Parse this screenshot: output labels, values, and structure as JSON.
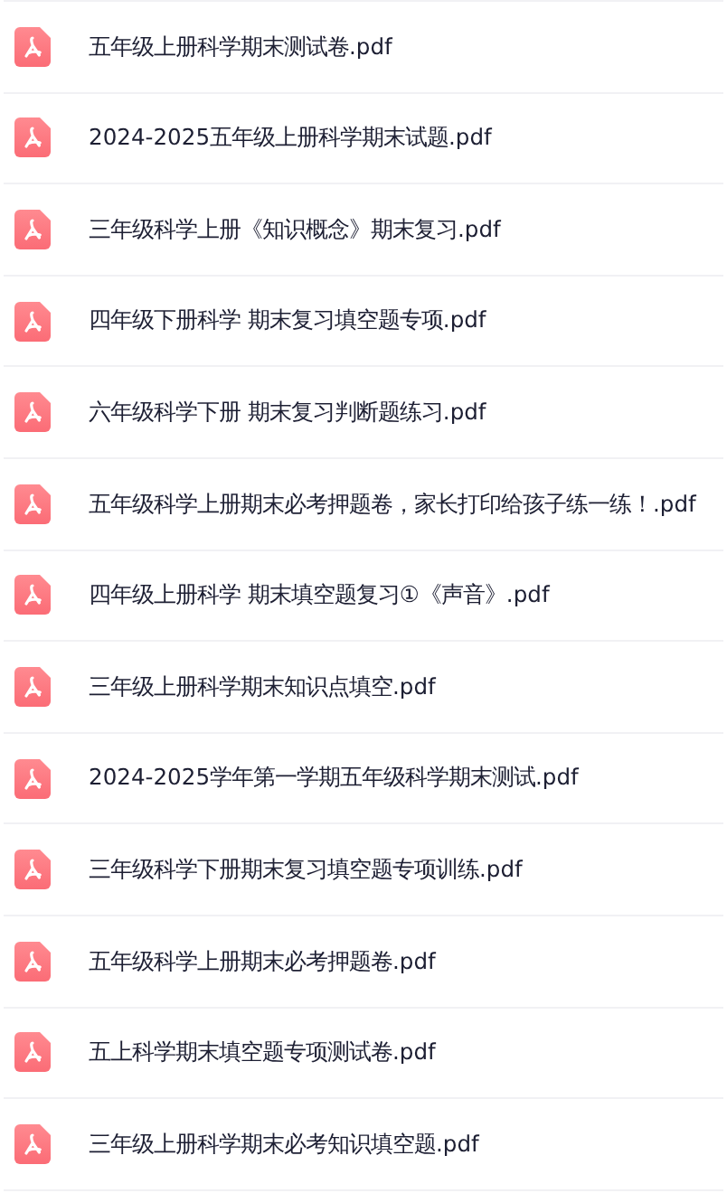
{
  "files": [
    {
      "name": "五年级上册科学期末测试卷.pdf"
    },
    {
      "name": "2024-2025五年级上册科学期末试题.pdf"
    },
    {
      "name": "三年级科学上册《知识概念》期末复习.pdf"
    },
    {
      "name": "四年级下册科学 期末复习填空题专项.pdf"
    },
    {
      "name": "六年级科学下册 期末复习判断题练习.pdf"
    },
    {
      "name": "五年级科学上册期末必考押题卷，家长打印给孩子练一练！.pdf"
    },
    {
      "name": "四年级上册科学 期末填空题复习①《声音》.pdf"
    },
    {
      "name": "三年级上册科学期末知识点填空.pdf"
    },
    {
      "name": "2024-2025学年第一学期五年级科学期末测试.pdf"
    },
    {
      "name": "三年级科学下册期末复习填空题专项训练.pdf"
    },
    {
      "name": "五年级科学上册期末必考押题卷.pdf"
    },
    {
      "name": "五上科学期末填空题专项测试卷.pdf"
    },
    {
      "name": "三年级上册科学期末必考知识填空题.pdf"
    }
  ]
}
